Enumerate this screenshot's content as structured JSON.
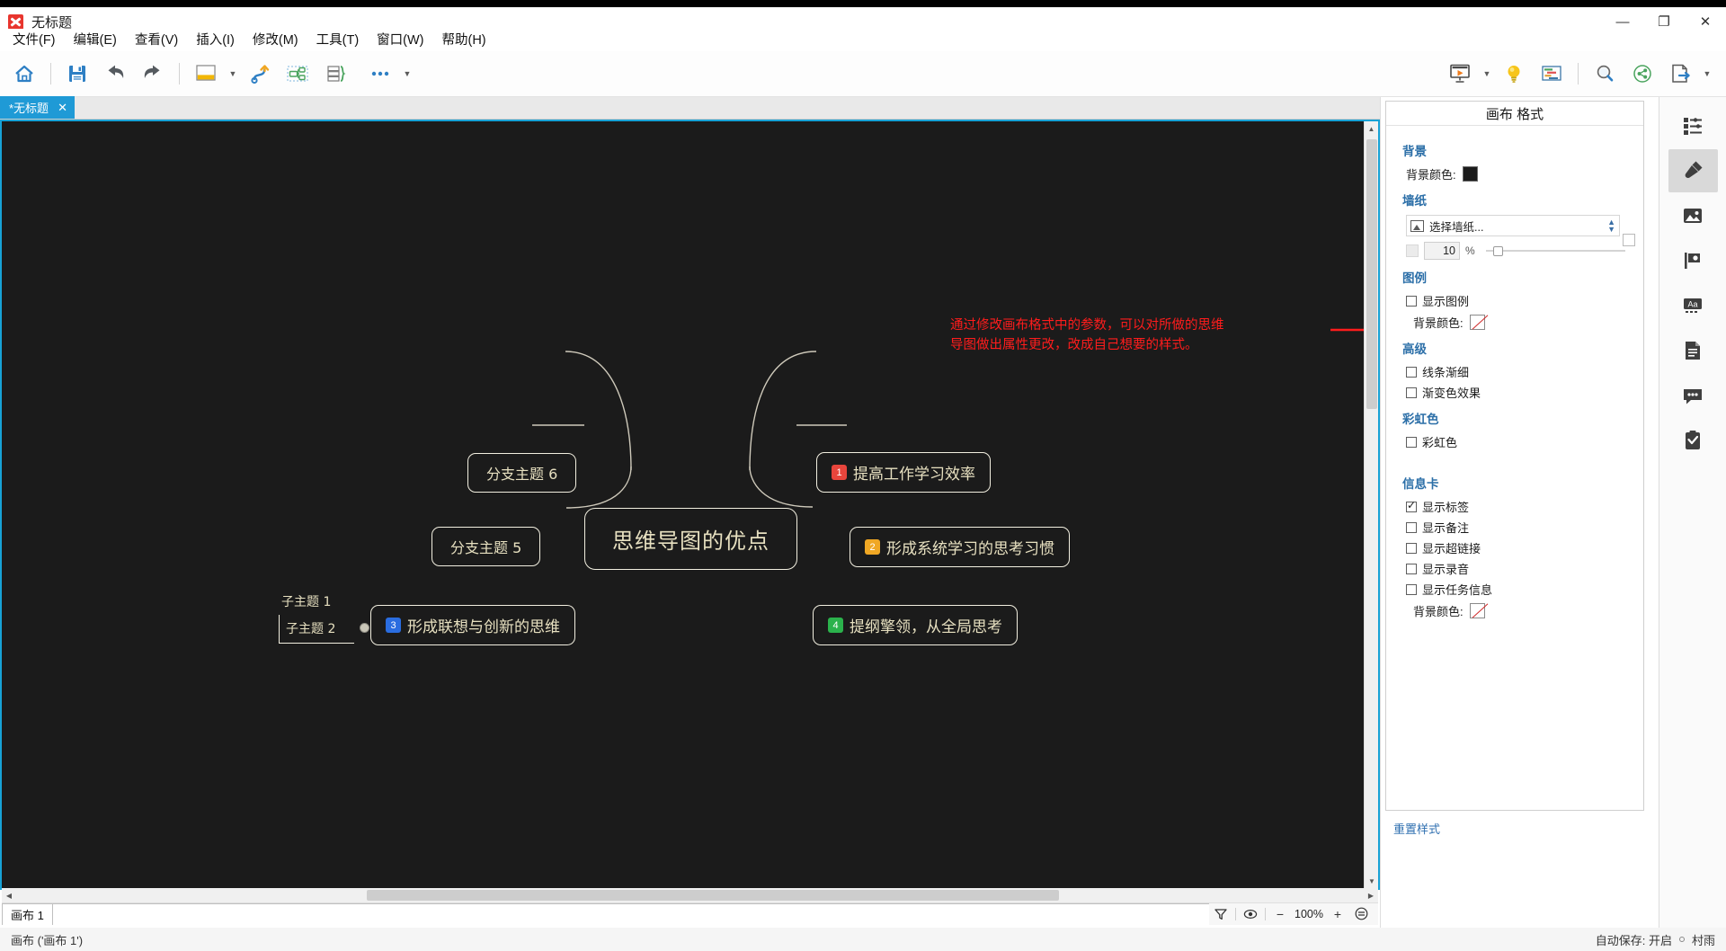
{
  "window": {
    "app_name": "XMind",
    "title": "无标题",
    "minimize_label": "—",
    "maximize_label": "❐",
    "close_label": "✕"
  },
  "menubar": {
    "items": [
      {
        "label": "文件(F)",
        "name": "menu-file"
      },
      {
        "label": "编辑(E)",
        "name": "menu-edit"
      },
      {
        "label": "查看(V)",
        "name": "menu-view"
      },
      {
        "label": "插入(I)",
        "name": "menu-insert"
      },
      {
        "label": "修改(M)",
        "name": "menu-modify"
      },
      {
        "label": "工具(T)",
        "name": "menu-tools"
      },
      {
        "label": "窗口(W)",
        "name": "menu-window"
      },
      {
        "label": "帮助(H)",
        "name": "menu-help"
      }
    ]
  },
  "toolbar": {
    "left": [
      {
        "icon": "home-icon",
        "label": "主页"
      },
      {
        "icon": "save-icon",
        "label": "保存"
      },
      {
        "icon": "undo-icon",
        "label": "撤销"
      },
      {
        "icon": "redo-icon",
        "label": "重做"
      },
      {
        "icon": "theme-icon",
        "label": "主题"
      },
      {
        "icon": "structure-icon",
        "label": "结构"
      },
      {
        "icon": "relationship-icon",
        "label": "联系"
      },
      {
        "icon": "boundary-icon",
        "label": "外框"
      },
      {
        "icon": "more-icon",
        "label": "更多"
      }
    ],
    "right": [
      {
        "icon": "presentation-icon",
        "label": "演说模式"
      },
      {
        "icon": "brainstorm-icon",
        "label": "头脑风暴"
      },
      {
        "icon": "gantt-icon",
        "label": "甘特图"
      },
      {
        "icon": "zoom-search-icon",
        "label": "查找"
      },
      {
        "icon": "share-icon",
        "label": "分享"
      },
      {
        "icon": "export-icon",
        "label": "导出"
      }
    ]
  },
  "tabstrip": {
    "tabs": [
      {
        "label": "*无标题",
        "close": "✕",
        "active": true
      }
    ]
  },
  "canvas": {
    "background_color": "#1b1b1b",
    "annotation": "通过修改画布格式中的参数，可以对所做的思维\n导图做出属性更改，改成自己想要的样式。",
    "annotation_color": "#ff1c1c",
    "nodes": {
      "root": "思维导图的优点",
      "branch6": "分支主题 6",
      "branch5": "分支主题 5",
      "item1": {
        "badge": "1",
        "badge_color": "#e8453c",
        "text": "提高工作学习效率"
      },
      "item2": {
        "badge": "2",
        "badge_color": "#f0a724",
        "text": "形成系统学习的思考习惯"
      },
      "item3": {
        "badge": "3",
        "badge_color": "#2a6de0",
        "text": "形成联想与创新的思维"
      },
      "item4": {
        "badge": "4",
        "badge_color": "#2bb24c",
        "text": "提纲擎领，从全局思考"
      },
      "sub1": "子主题 1",
      "sub2": "子主题 2"
    }
  },
  "sheetbar": {
    "sheet_name": "画布 1",
    "filter_icon": "filter-icon",
    "eye_icon": "eye-icon",
    "zoom_out": "−",
    "zoom_value": "100%",
    "zoom_in": "+",
    "fit_icon": "fit-screen-icon"
  },
  "statusbar": {
    "left_text": "画布 ('画布 1')",
    "autosave_text": "自动保存: 开启",
    "user_name": "村雨"
  },
  "panel": {
    "title": "画布 格式",
    "groups": [
      {
        "name": "背景",
        "heading": "背景",
        "rows": [
          {
            "label": "背景颜色:",
            "type": "color",
            "value": "#1b1b1b"
          }
        ]
      },
      {
        "name": "墙纸",
        "heading": "墙纸",
        "combo_label": "选择墙纸...",
        "opacity_value": "10",
        "opacity_unit": "%"
      },
      {
        "name": "图例",
        "heading": "图例",
        "checkboxes": [
          {
            "label": "显示图例",
            "checked": false
          }
        ],
        "rows": [
          {
            "label": "背景颜色:",
            "type": "none"
          }
        ]
      },
      {
        "name": "高级",
        "heading": "高级",
        "checkboxes": [
          {
            "label": "线条渐细",
            "checked": false
          },
          {
            "label": "渐变色效果",
            "checked": false
          }
        ]
      },
      {
        "name": "彩虹色",
        "heading": "彩虹色",
        "checkboxes": [
          {
            "label": "彩虹色",
            "checked": false
          }
        ]
      },
      {
        "name": "信息卡",
        "heading": "信息卡",
        "checkboxes": [
          {
            "label": "显示标签",
            "checked": true
          },
          {
            "label": "显示备注",
            "checked": false
          },
          {
            "label": "显示超链接",
            "checked": false
          },
          {
            "label": "显示录音",
            "checked": false
          },
          {
            "label": "显示任务信息",
            "checked": false
          }
        ],
        "rows": [
          {
            "label": "背景颜色:",
            "type": "none"
          }
        ]
      }
    ],
    "reset_link": "重置样式"
  },
  "rail": {
    "items": [
      {
        "icon": "outline-icon",
        "label": "大纲",
        "active": false
      },
      {
        "icon": "brush-icon",
        "label": "样式",
        "active": true
      },
      {
        "icon": "image-icon",
        "label": "图片",
        "active": false
      },
      {
        "icon": "marker-flag-icon",
        "label": "标记",
        "active": false
      },
      {
        "icon": "text-aa-icon",
        "label": "文本",
        "active": false
      },
      {
        "icon": "notes-icon",
        "label": "备注",
        "active": false
      },
      {
        "icon": "comment-icon",
        "label": "评论",
        "active": false
      },
      {
        "icon": "task-icon",
        "label": "任务",
        "active": false
      }
    ]
  }
}
